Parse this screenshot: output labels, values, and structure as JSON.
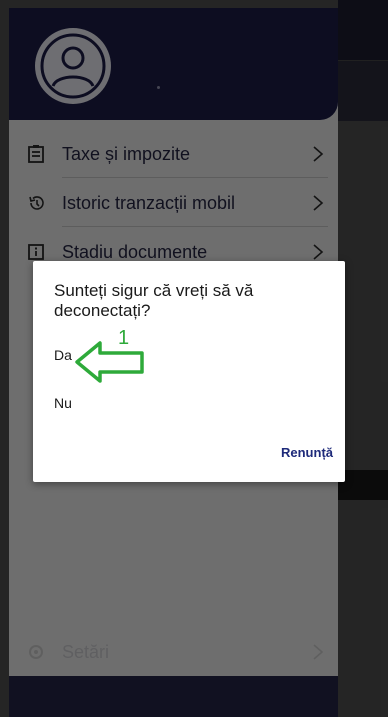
{
  "drawer": {
    "menu": [
      {
        "label": "Taxe și impozite",
        "icon": "clipboard-icon"
      },
      {
        "label": "Istoric tranzacții mobil",
        "icon": "history-icon"
      },
      {
        "label": "Stadiu documente",
        "icon": "info-icon"
      }
    ],
    "faded_item": {
      "label": "Setări",
      "icon": "gear-icon"
    }
  },
  "dialog": {
    "title": "Sunteți sigur că vreți să vă deconectați?",
    "option_yes": "Da",
    "option_no": "Nu",
    "cancel": "Renunță"
  },
  "annotation": {
    "number": "1",
    "color": "#2eaa3a"
  }
}
